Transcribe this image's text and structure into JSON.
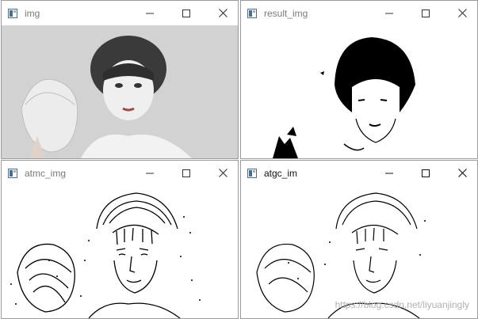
{
  "windows": [
    {
      "id": "img",
      "title": "img",
      "active": false,
      "content_style": "grayscale-photo"
    },
    {
      "id": "result",
      "title": "result_img",
      "active": false,
      "content_style": "binary-threshold"
    },
    {
      "id": "atmc",
      "title": "atmc_img",
      "active": false,
      "content_style": "adaptive-threshold-mean"
    },
    {
      "id": "atgc",
      "title": "atgc_im",
      "active": true,
      "content_style": "adaptive-threshold-gaussian"
    }
  ],
  "controls": {
    "minimize_icon": "minimize-icon",
    "maximize_icon": "maximize-icon",
    "close_icon": "close-icon"
  },
  "watermark": "https://blog.csdn.net/liyuanjingly",
  "colors": {
    "title_inactive": "#7a7a7a",
    "title_active": "#111111",
    "gray_bg": "#d2d2d2"
  }
}
